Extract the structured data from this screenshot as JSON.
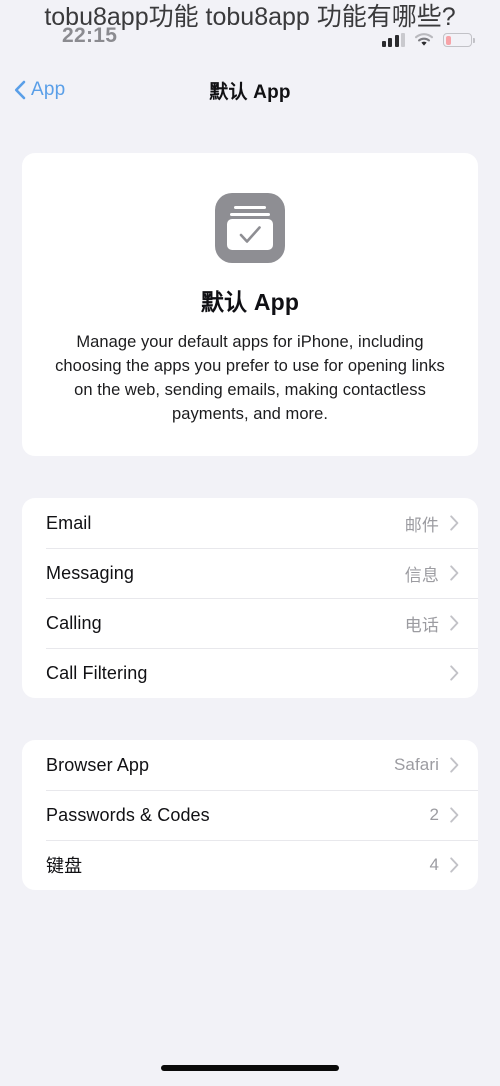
{
  "overlay": {
    "title": "tobu8app功能 tobu8app 功能有哪些?"
  },
  "status_bar": {
    "time": "22:15",
    "signal_icon": "cellular-bars-icon",
    "wifi_icon": "wifi-icon",
    "battery_icon": "battery-low-icon",
    "battery_level_percent": 22,
    "battery_color": "#f7a3a8"
  },
  "nav": {
    "back_label": "App",
    "back_icon": "chevron-left-icon",
    "title": "默认 App",
    "accent_color": "#5a9fe8"
  },
  "hero": {
    "icon_name": "default-apps-icon",
    "title": "默认 App",
    "description": "Manage your default apps for iPhone, including choosing the apps you prefer to use for opening links on the web, sending emails, making contactless payments, and more."
  },
  "groups": [
    {
      "name": "default-apps-group",
      "rows": [
        {
          "label": "Email",
          "value": "邮件",
          "chevron": "chevron-right-icon"
        },
        {
          "label": "Messaging",
          "value": "信息",
          "chevron": "chevron-right-icon"
        },
        {
          "label": "Calling",
          "value": "电话",
          "chevron": "chevron-right-icon"
        },
        {
          "label": "Call Filtering",
          "value": "",
          "chevron": "chevron-right-icon"
        }
      ]
    },
    {
      "name": "browser-and-input-group",
      "rows": [
        {
          "label": "Browser App",
          "value": "Safari",
          "chevron": "chevron-right-icon"
        },
        {
          "label": "Passwords & Codes",
          "value": "2",
          "chevron": "chevron-right-icon"
        },
        {
          "label": "键盘",
          "value": "4",
          "chevron": "chevron-right-icon"
        }
      ]
    }
  ],
  "home_indicator": "home-indicator"
}
